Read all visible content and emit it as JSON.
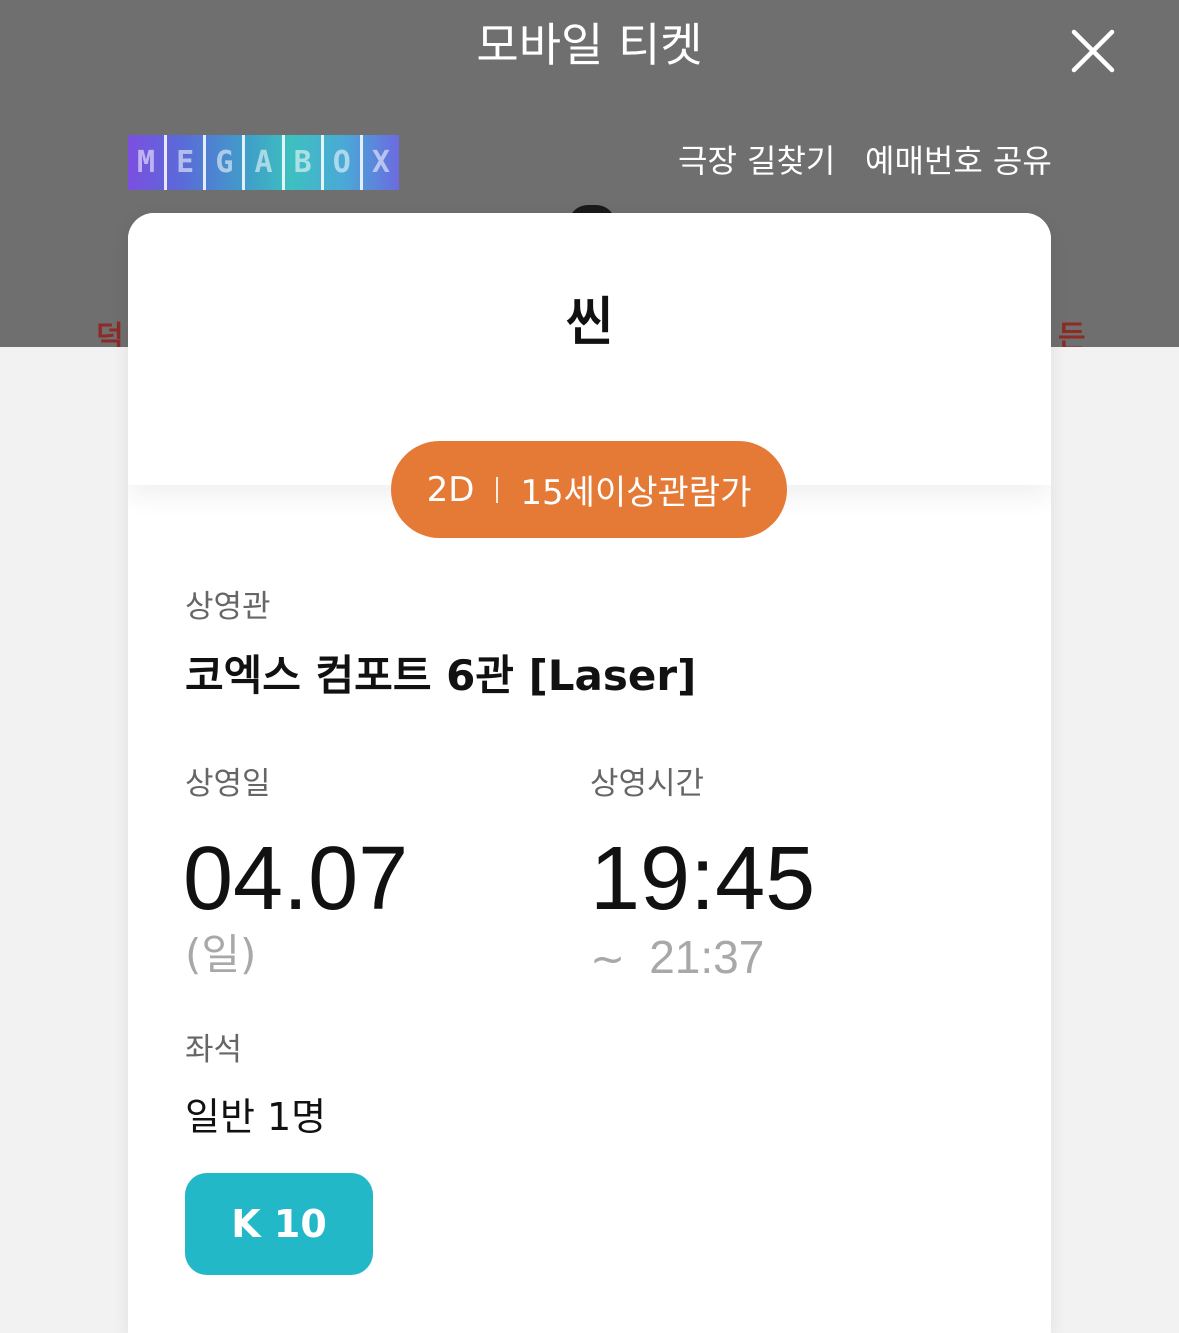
{
  "header": {
    "title": "모바일 티켓",
    "close_icon": "close-icon",
    "background_color": "#6f6f6f",
    "logo_letters": [
      "M",
      "E",
      "G",
      "A",
      "B",
      "O",
      "X"
    ],
    "links": {
      "directions": "극장 길찾기",
      "share": "예매번호 공유"
    },
    "poster_fragments": {
      "left": "덕",
      "right": "든"
    }
  },
  "ticket": {
    "movie_title": "씬",
    "format": "2D",
    "rating": "15세이상관람가",
    "badge_color": "#e57a36",
    "theater_label": "상영관",
    "theater_value": "코엑스 컴포트 6관 [Laser]",
    "date_label": "상영일",
    "date_value": "04.07",
    "day_of_week": "(일)",
    "time_label": "상영시간",
    "start_time": "19:45",
    "end_prefix": "~",
    "end_time": "21:37",
    "seat_label": "좌석",
    "seat_value": "일반 1명",
    "seat_number": "K 10",
    "seat_chip_color": "#22b8c8"
  }
}
